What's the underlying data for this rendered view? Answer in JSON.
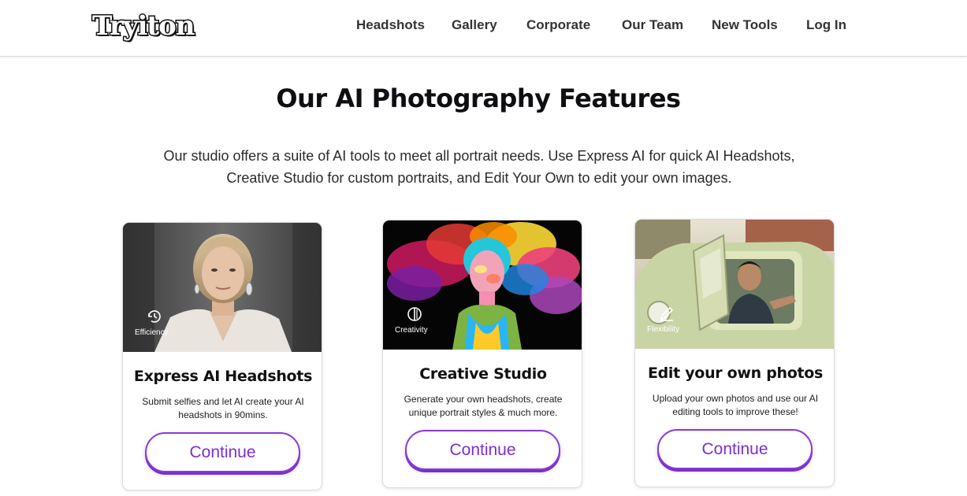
{
  "header": {
    "logo_text": "Tryiton",
    "nav": [
      {
        "label": "Headshots"
      },
      {
        "label": "Gallery"
      },
      {
        "label": "Corporate"
      },
      {
        "label": "Our Team"
      },
      {
        "label": "New Tools"
      },
      {
        "label": "Log In"
      }
    ]
  },
  "hero": {
    "title": "Our AI Photography Features",
    "subtitle": "Our studio offers a suite of AI tools to meet all portrait needs. Use Express AI for quick AI Headshots, Creative Studio for custom portraits, and Edit Your Own to edit your own images."
  },
  "cards": [
    {
      "badge_icon": "clock-icon",
      "badge_label": "Efficiency",
      "title": "Express AI Headshots",
      "description": "Submit selfies and let AI create your AI headshots in 90mins.",
      "button_label": "Continue"
    },
    {
      "badge_icon": "half-circle-icon",
      "badge_label": "Creativity",
      "title": "Creative Studio",
      "description": "Generate your own headshots, create unique portrait styles & much more.",
      "button_label": "Continue"
    },
    {
      "badge_icon": "pencil-icon",
      "badge_label": "Flexibility",
      "title": "Edit your own photos",
      "description": "Upload your own photos and use our AI editing tools to improve these!",
      "button_label": "Continue"
    }
  ],
  "colors": {
    "accent": "#7a2fcf",
    "text": "#111111",
    "header_border": "#d9d9d9"
  }
}
